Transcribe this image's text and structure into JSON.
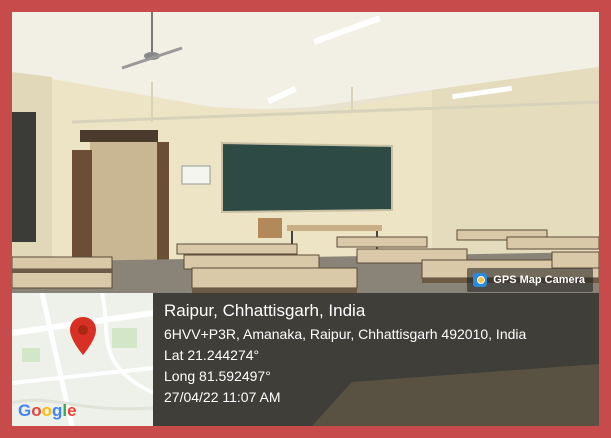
{
  "badge": {
    "label": "GPS Map Camera",
    "icon": "camera-app-icon"
  },
  "location": {
    "title": "Raipur, Chhattisgarh, India",
    "address": "6HVV+P3R, Amanaka, Raipur, Chhattisgarh 492010, India",
    "lat": "Lat 21.244274°",
    "long": "Long 81.592497°",
    "datetime": "27/04/22 11:07 AM"
  },
  "map": {
    "logo": "Google",
    "pin_color": "#d93025"
  },
  "colors": {
    "frame": "#c84b4b",
    "chalkboard": "#2e4a44"
  }
}
